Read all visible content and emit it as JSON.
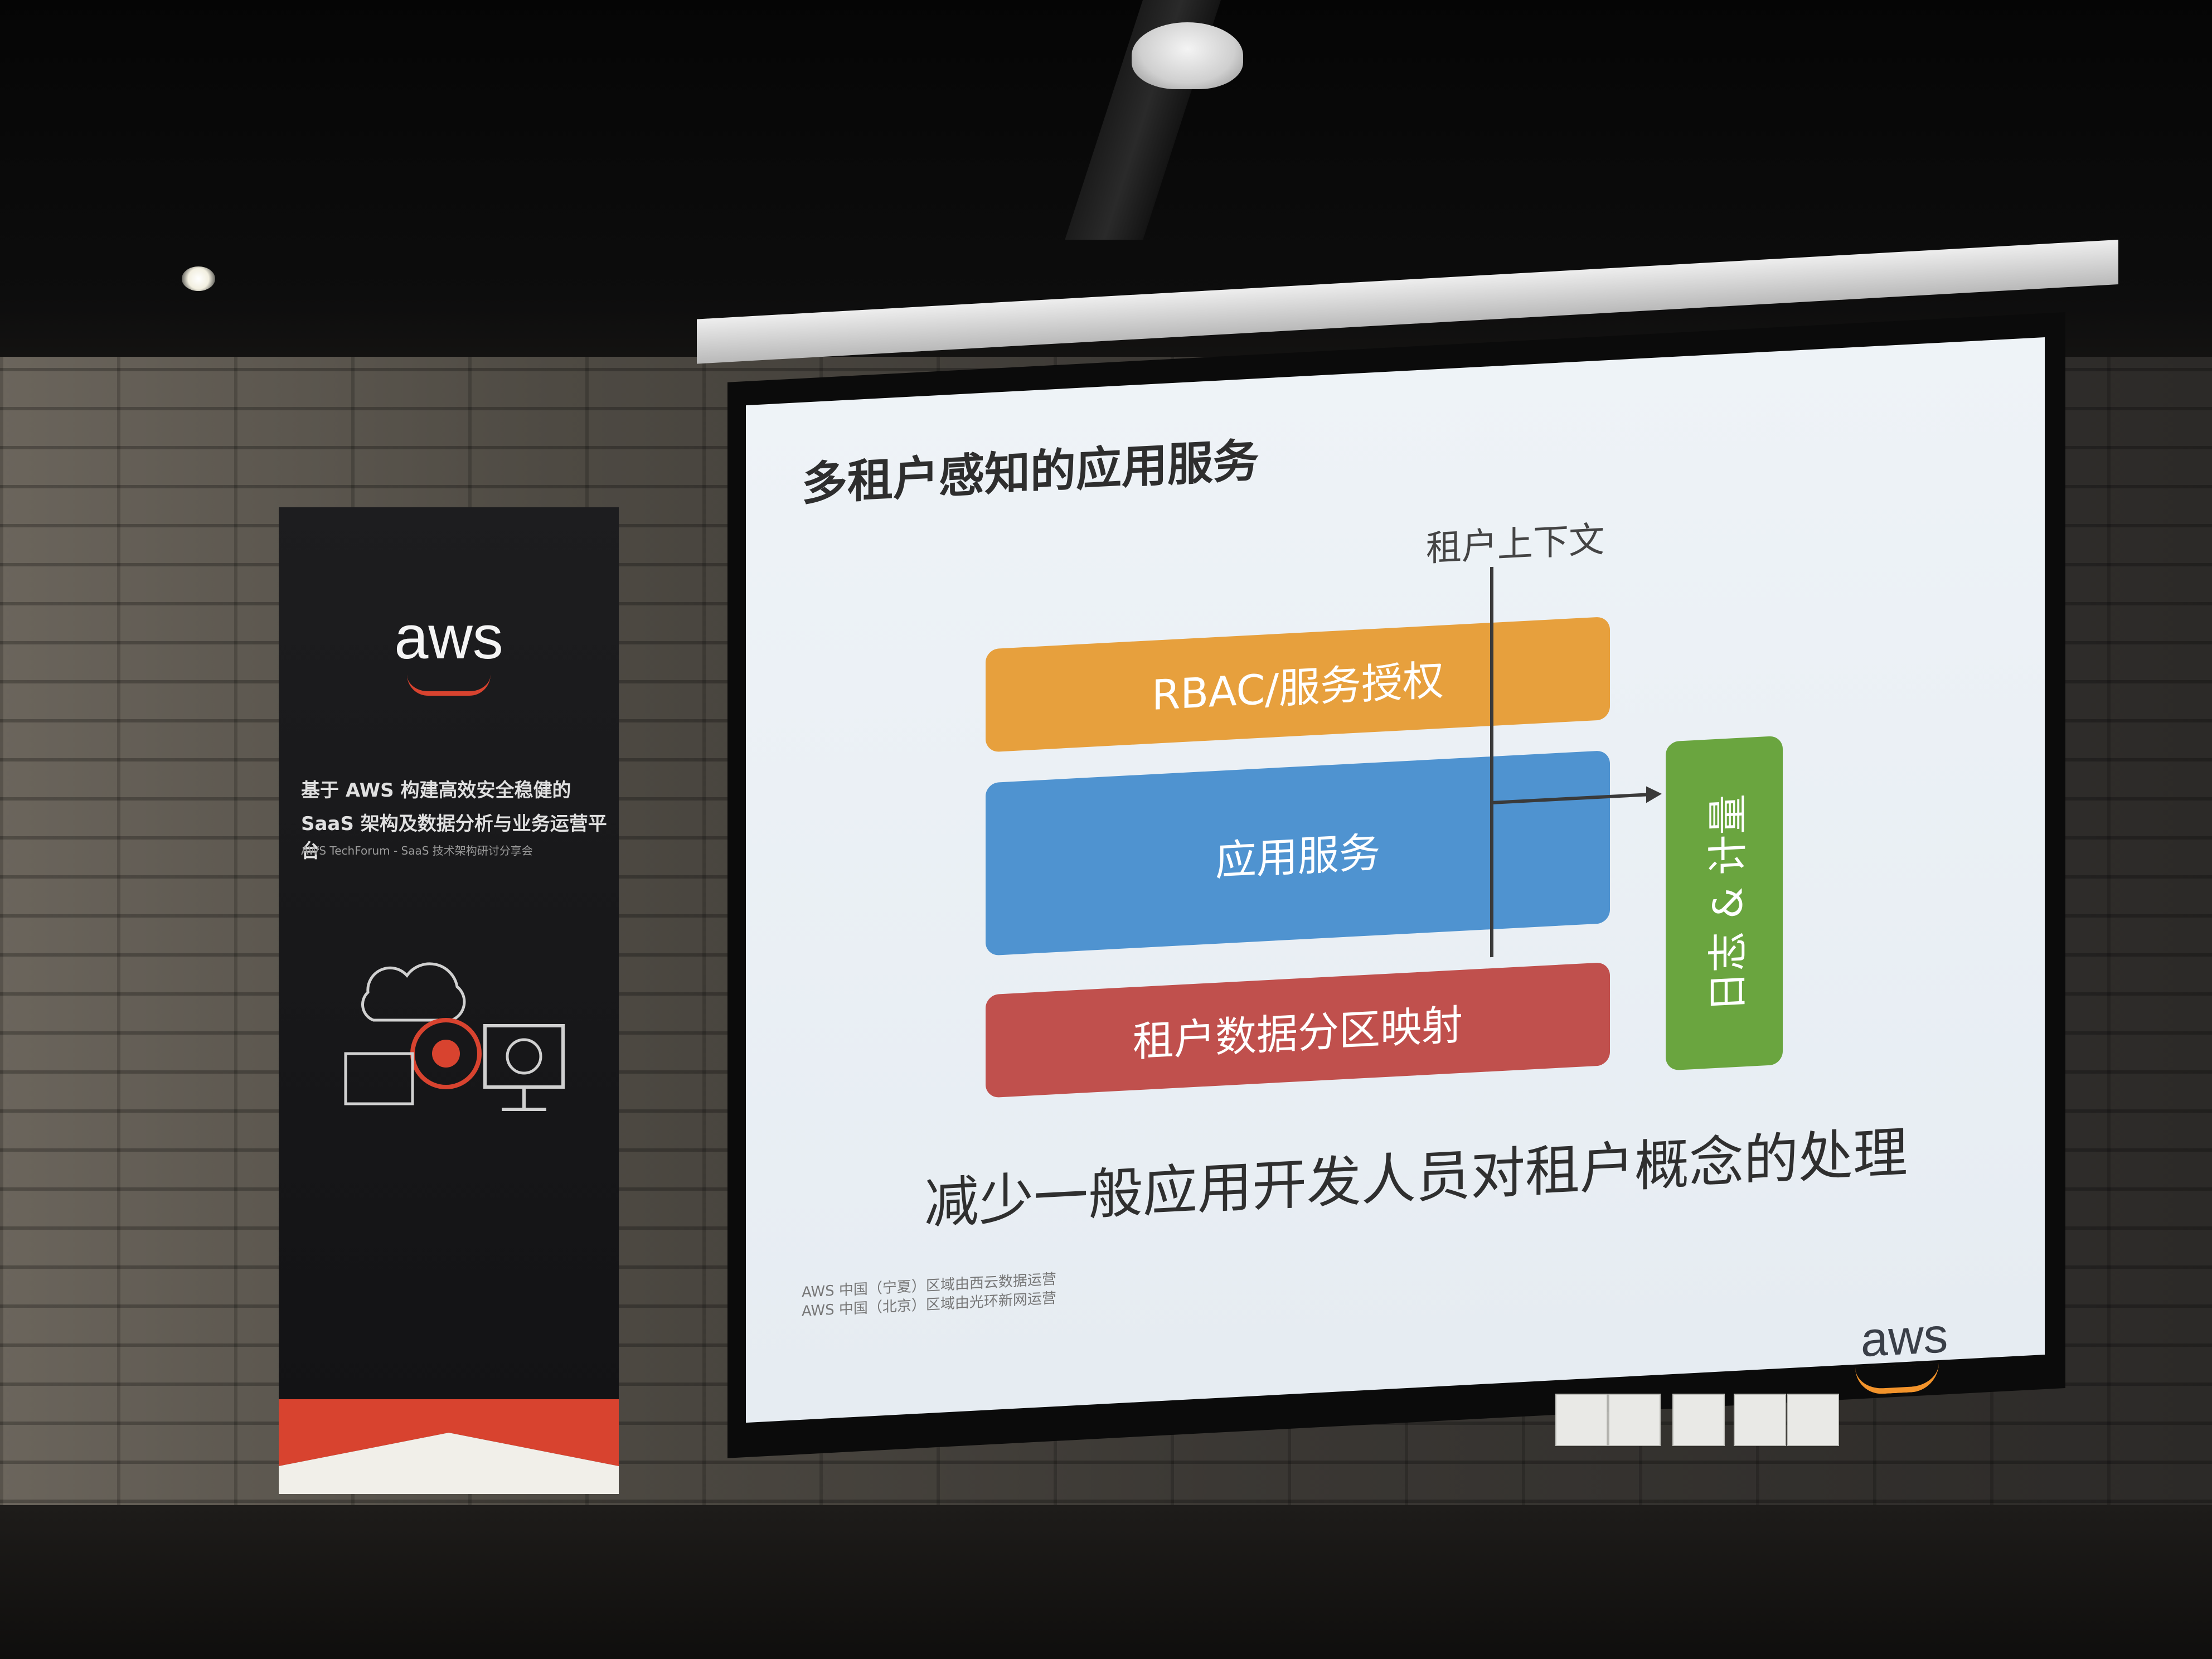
{
  "slide": {
    "title": "多租户感知的应用服务",
    "context_label": "租户上下文",
    "layers": {
      "rbac": "RBAC/服务授权",
      "app_service": "应用服务",
      "data_partition": "租户数据分区映射",
      "logging": "日志 & 计量"
    },
    "subtitle": "减少一般应用开发人员对租户概念的处理",
    "footnote_line1": "AWS 中国（宁夏）区域由西云数据运营",
    "footnote_line2": "AWS 中国（北京）区域由光环新网运营",
    "logo": "aws"
  },
  "banner": {
    "logo": "aws",
    "line1": "基于 AWS 构建高效安全稳健的",
    "line2": "SaaS 架构及数据分析与业务运营平台",
    "line3": "AWS TechForum - SaaS 技术架构研讨分享会"
  },
  "colors": {
    "rbac": "#e7a03d",
    "app_service": "#4f93d0",
    "data_partition": "#c0504d",
    "logging": "#6aa53f",
    "aws_orange": "#f2932b",
    "banner_red": "#d8432f"
  }
}
